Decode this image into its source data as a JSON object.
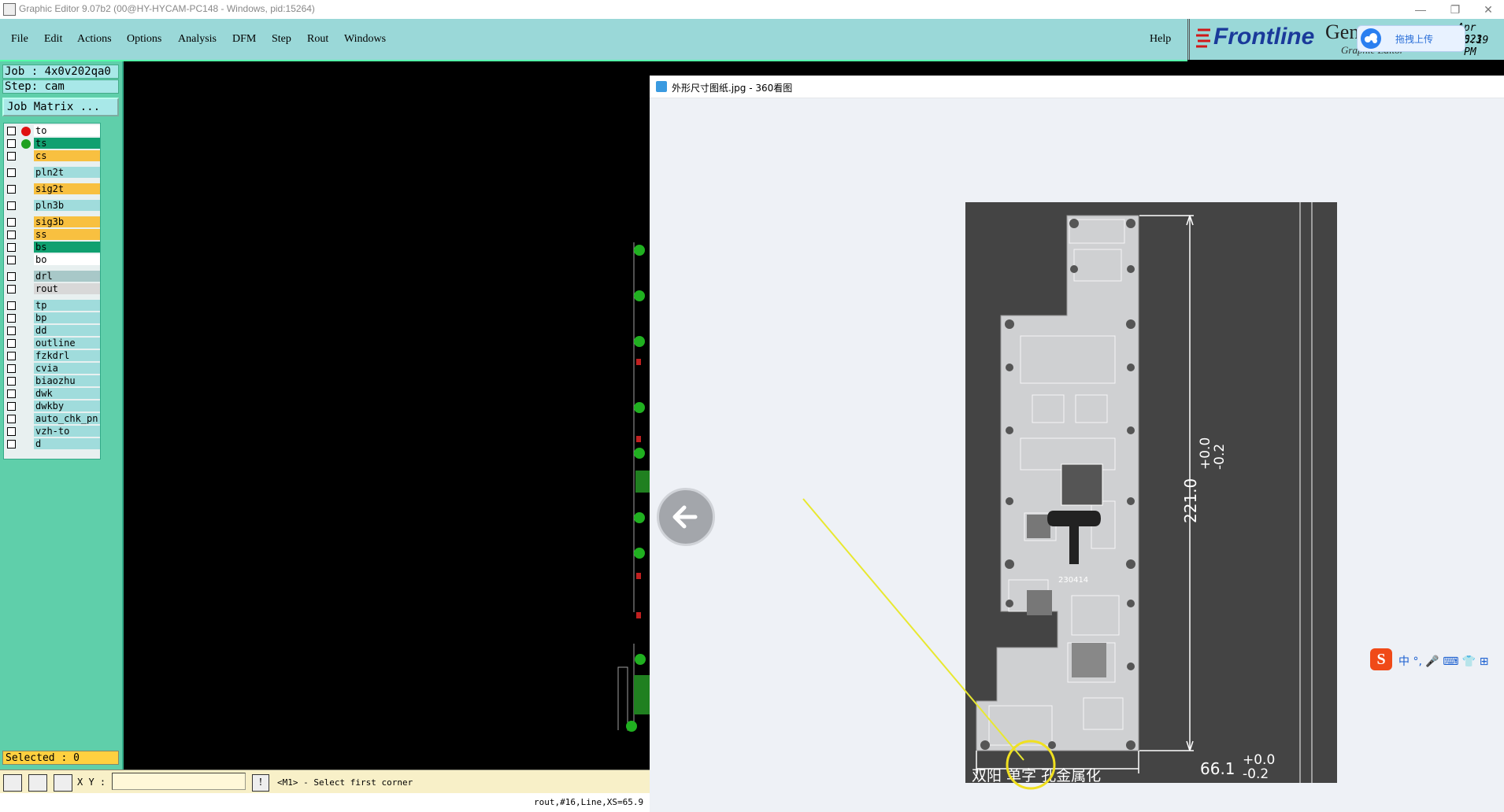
{
  "titlebar": {
    "title": "Graphic Editor 9.07b2 (00@HY-HYCAM-PC148 - Windows, pid:15264)",
    "minimize": "—",
    "restore": "❐",
    "close": "✕"
  },
  "menu": [
    "File",
    "Edit",
    "Actions",
    "Options",
    "Analysis",
    "DFM",
    "Step",
    "Rout",
    "Windows"
  ],
  "help": "Help",
  "brand": {
    "logo": "Frontline",
    "gen": "Gen",
    "sub": "Graphic Editor",
    "date": "Apr 2023",
    "time": "5:19 PM",
    "upload": "拖拽上传"
  },
  "job": "Job : 4x0v202qa0",
  "step": "Step: cam",
  "job_matrix": "Job Matrix ...",
  "layers": [
    {
      "name": "to",
      "color": "#ffffff",
      "dot": "#e01010"
    },
    {
      "name": "ts",
      "color": "#10a070",
      "dot": "#20a020"
    },
    {
      "name": "cs",
      "color": "#f8c040"
    },
    {
      "name": "pln2t",
      "color": "#a0dcdc"
    },
    {
      "name": "sig2t",
      "color": "#f8c040"
    },
    {
      "name": "pln3b",
      "color": "#a0dcdc"
    },
    {
      "name": "sig3b",
      "color": "#f8c040"
    },
    {
      "name": "ss",
      "color": "#f8c040"
    },
    {
      "name": "bs",
      "color": "#10a070"
    },
    {
      "name": "bo",
      "color": "#ffffff"
    },
    {
      "name": "drl",
      "color": "#a8c8c8"
    },
    {
      "name": "rout",
      "color": "#d8d8d8"
    },
    {
      "name": "tp",
      "color": "#a0dcdc"
    },
    {
      "name": "bp",
      "color": "#a0dcdc"
    },
    {
      "name": "dd",
      "color": "#a0dcdc"
    },
    {
      "name": "outline",
      "color": "#a0dcdc"
    },
    {
      "name": "fzkdrl",
      "color": "#a0dcdc"
    },
    {
      "name": "cvia",
      "color": "#a0dcdc"
    },
    {
      "name": "biaozhu",
      "color": "#a0dcdc"
    },
    {
      "name": "dwk",
      "color": "#a0dcdc"
    },
    {
      "name": "dwkby",
      "color": "#a0dcdc"
    },
    {
      "name": "auto_chk_pn",
      "color": "#a0dcdc"
    },
    {
      "name": "vzh-to",
      "color": "#a0dcdc"
    },
    {
      "name": "d",
      "color": "#a0dcdc"
    }
  ],
  "selected": "Selected : 0",
  "xy_label": "X Y :",
  "xy_value": "",
  "prompt": "<M1> - Select first corner",
  "status": "rout,#16,Line,XS=65.9",
  "viewer": {
    "filename": "外形尺寸图纸.jpg - 360看图",
    "dim_vertical": "221.0",
    "tol_plus": "+0.0",
    "tol_minus": "-0.2",
    "dim_horizontal": "66.1",
    "note": "双阳 单字 孔金属化",
    "board_code": "230414",
    "ime": "中 °, 🎤 ⌨ 👕 ⊞"
  }
}
